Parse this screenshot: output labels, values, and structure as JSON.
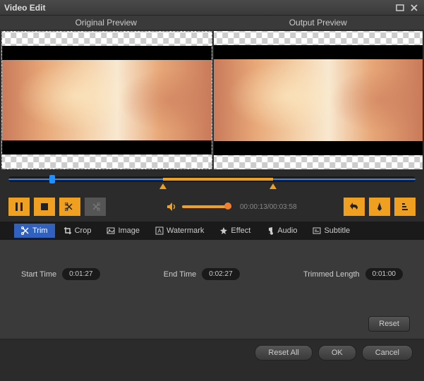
{
  "window": {
    "title": "Video Edit"
  },
  "previews": {
    "original": "Original Preview",
    "output": "Output Preview"
  },
  "timeline": {
    "progress_pct": 10,
    "trim_start_pct": 38,
    "trim_end_pct": 65,
    "full_pct": 100
  },
  "playback": {
    "timecode": "00:00:13/00:03:58"
  },
  "tabs": [
    {
      "label": "Trim",
      "icon": "scissors-icon",
      "active": true
    },
    {
      "label": "Crop",
      "icon": "crop-icon",
      "active": false
    },
    {
      "label": "Image",
      "icon": "image-icon",
      "active": false
    },
    {
      "label": "Watermark",
      "icon": "watermark-icon",
      "active": false
    },
    {
      "label": "Effect",
      "icon": "star-icon",
      "active": false
    },
    {
      "label": "Audio",
      "icon": "note-icon",
      "active": false
    },
    {
      "label": "Subtitle",
      "icon": "subtitle-icon",
      "active": false
    }
  ],
  "trim": {
    "start_label": "Start Time",
    "start_value": "0:01:27",
    "end_label": "End Time",
    "end_value": "0:02:27",
    "length_label": "Trimmed Length",
    "length_value": "0:01:00",
    "reset_label": "Reset"
  },
  "footer": {
    "reset_all": "Reset All",
    "ok": "OK",
    "cancel": "Cancel"
  }
}
